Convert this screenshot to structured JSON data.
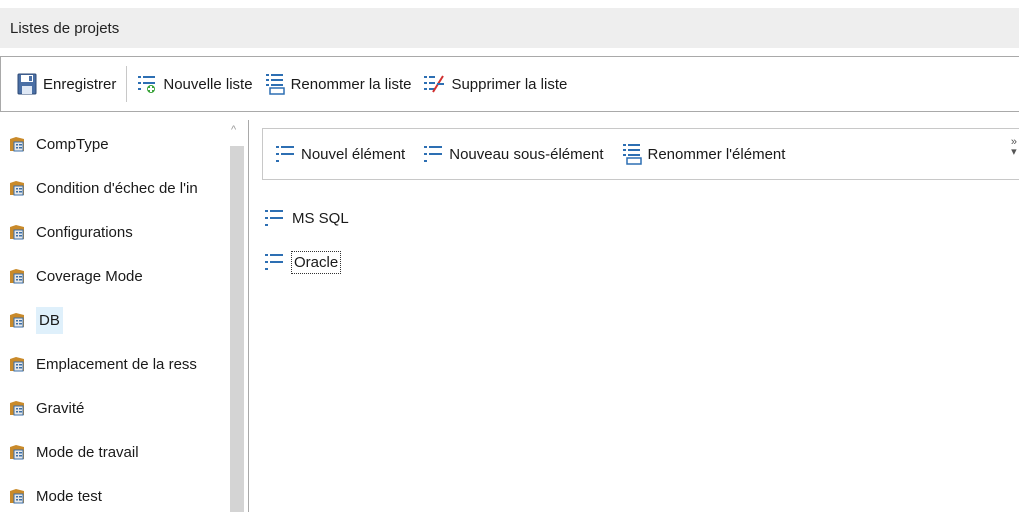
{
  "window": {
    "title": "Listes de projets"
  },
  "toolbar": {
    "save_label": "Enregistrer",
    "new_list_label": "Nouvelle liste",
    "rename_list_label": "Renommer la liste",
    "delete_list_label": "Supprimer la liste"
  },
  "sidebar": {
    "items": [
      {
        "label": "CompType",
        "icon": "list-folder-icon"
      },
      {
        "label": "Condition d'échec de l'in",
        "icon": "list-folder-icon"
      },
      {
        "label": "Configurations",
        "icon": "list-folder-icon"
      },
      {
        "label": "Coverage Mode",
        "icon": "list-folder-icon"
      },
      {
        "label": "DB",
        "icon": "list-folder-icon",
        "selected": true
      },
      {
        "label": "Emplacement de la ress",
        "icon": "list-folder-icon"
      },
      {
        "label": "Gravité",
        "icon": "list-folder-icon"
      },
      {
        "label": "Mode de travail",
        "icon": "list-folder-icon"
      },
      {
        "label": "Mode test",
        "icon": "list-folder-icon"
      }
    ]
  },
  "item_toolbar": {
    "new_item_label": "Nouvel élément",
    "new_subitem_label": "Nouveau sous-élément",
    "rename_item_label": "Renommer l'élément",
    "overflow": "»"
  },
  "items": [
    {
      "label": "MS SQL",
      "icon": "list-item-icon"
    },
    {
      "label": "Oracle",
      "icon": "list-item-icon",
      "focused": true
    }
  ],
  "colors": {
    "selection": "#dff0fb",
    "title_bg": "#eeeeee",
    "border": "#a9a9a9"
  }
}
